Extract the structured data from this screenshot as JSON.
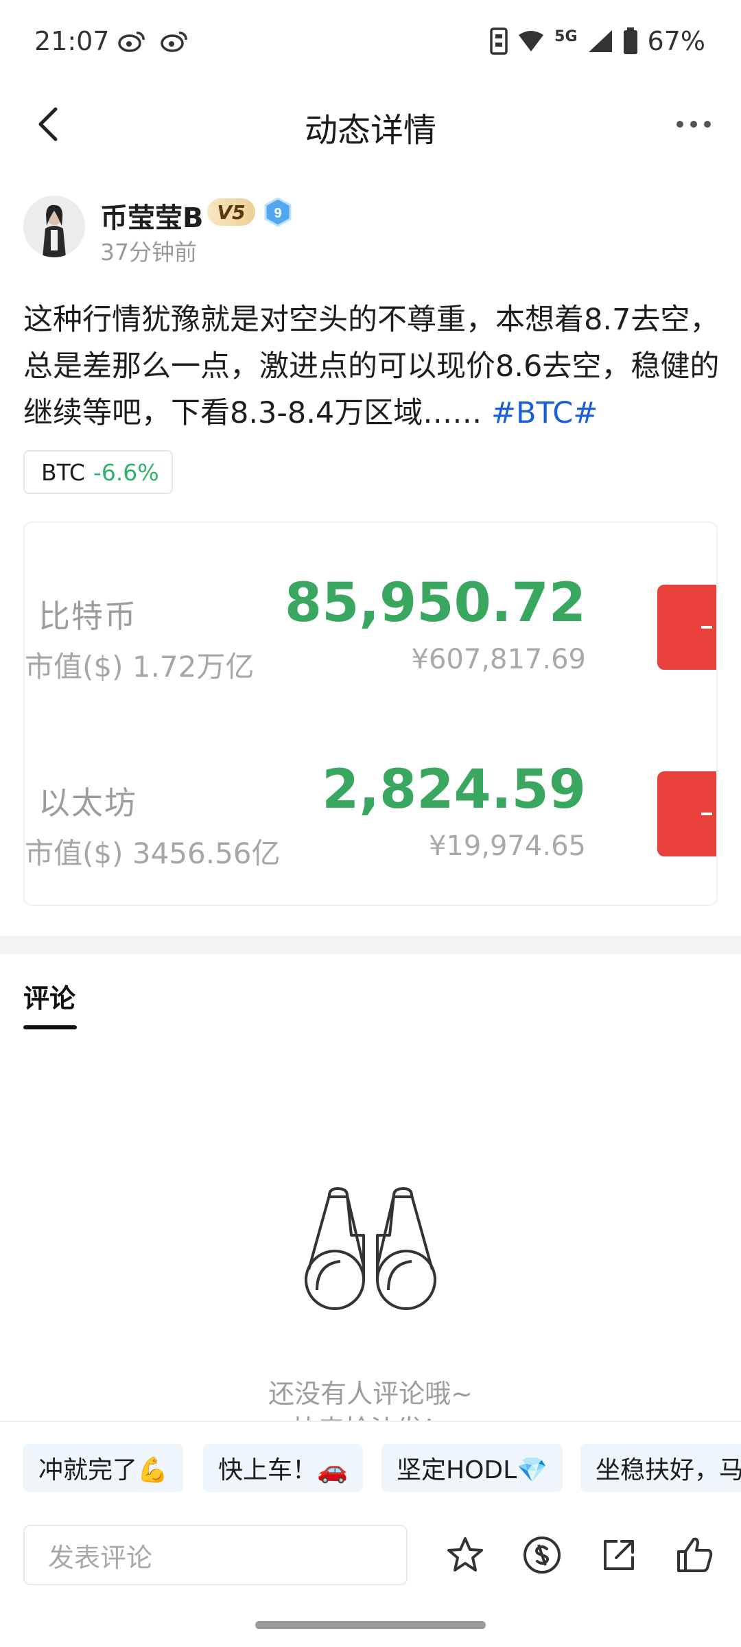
{
  "status_bar": {
    "time": "21:07",
    "network": "5G",
    "battery": "67%"
  },
  "header": {
    "title": "动态详情"
  },
  "author": {
    "name": "币莹莹B",
    "vip_badge": "V5",
    "level": "9",
    "time_ago": "37分钟前"
  },
  "post": {
    "text": "这种行情犹豫就是对空头的不尊重，本想着8.7去空，总是差那么一点，激进点的可以现价8.6去空，稳健的继续等吧，下看8.3-8.4万区域……",
    "hashtag": "#BTC#"
  },
  "coin_chip": {
    "symbol": "BTC",
    "change": "-6.6%"
  },
  "market": {
    "rows": [
      {
        "name": "比特币",
        "cap": "市值($) 1.72万亿",
        "price": "85,950.72",
        "price_cny": "¥607,817.69"
      },
      {
        "name": "以太坊",
        "cap": "市值($) 3456.56亿",
        "price": "2,824.59",
        "price_cny": "¥19,974.65"
      }
    ]
  },
  "comments": {
    "tab_label": "评论",
    "empty_line1": "还没有人评论哦~",
    "empty_line2": "快来抢沙发！"
  },
  "quick_replies": [
    {
      "label": "冲就完了💪"
    },
    {
      "label": "快上车！🚗"
    },
    {
      "label": "坚定HODL💎"
    },
    {
      "label": "坐稳扶好，马"
    }
  ],
  "bottom_bar": {
    "input_placeholder": "发表评论"
  },
  "colors": {
    "accent_blue": "#1a5fd6",
    "green": "#2fb36a",
    "red": "#e8413c"
  }
}
